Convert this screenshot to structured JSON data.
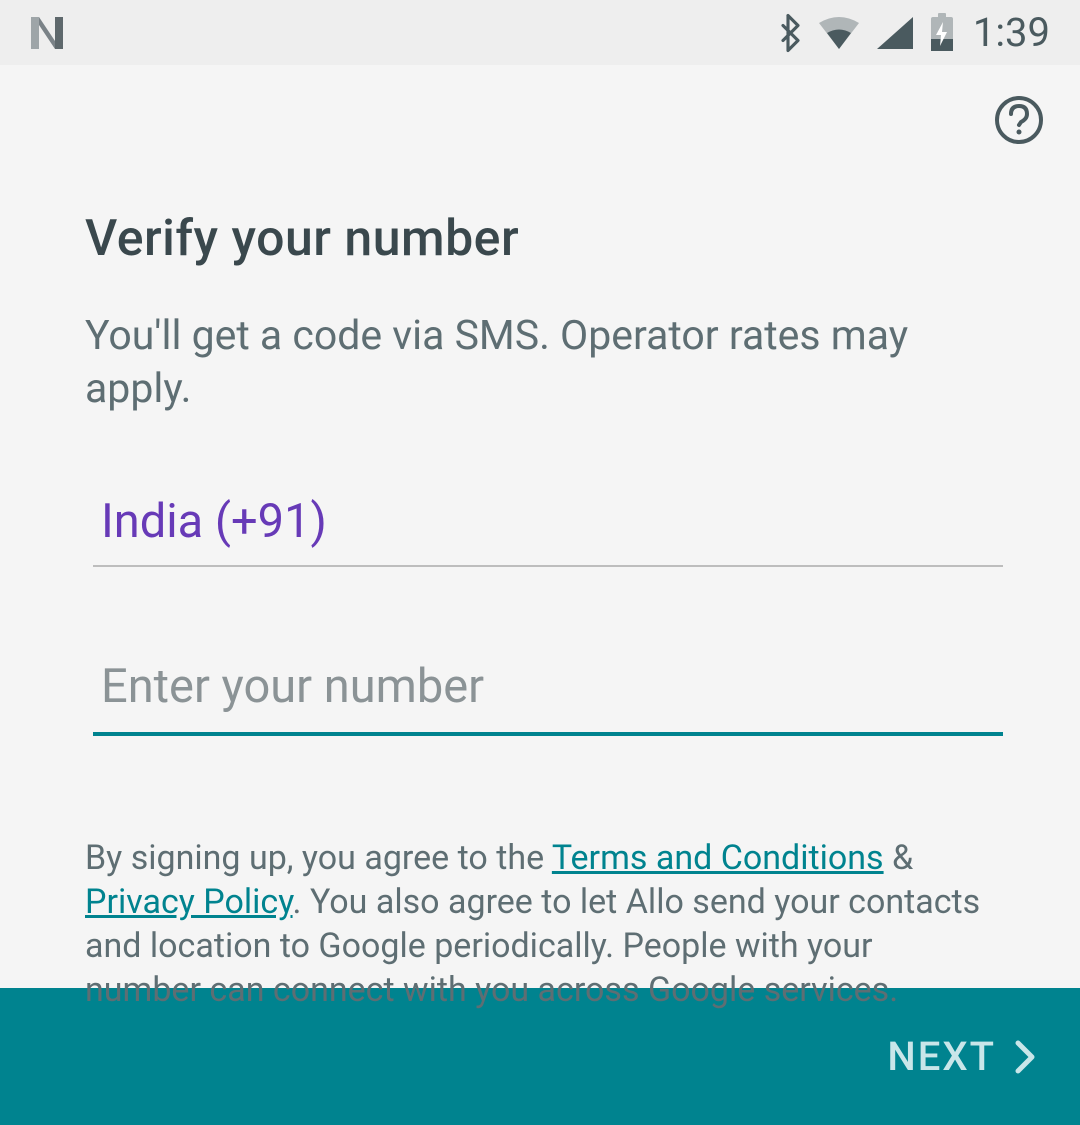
{
  "status_bar": {
    "time": "1:39"
  },
  "header": {
    "help_label": "Help"
  },
  "main": {
    "title": "Verify your number",
    "subtitle": "You'll get a code via SMS. Operator rates may apply.",
    "country_selected": "India (+91)",
    "phone_placeholder": "Enter your number",
    "phone_value": "",
    "terms": {
      "prefix": "By signing up, you agree to the ",
      "terms_link": "Terms and Conditions",
      "amp": " & ",
      "privacy_link": "Privacy Policy",
      "suffix": ". You also agree to let Allo send your contacts and location to Google periodically. People with your number can connect with you across Google services."
    }
  },
  "footer": {
    "next_label": "NEXT"
  }
}
